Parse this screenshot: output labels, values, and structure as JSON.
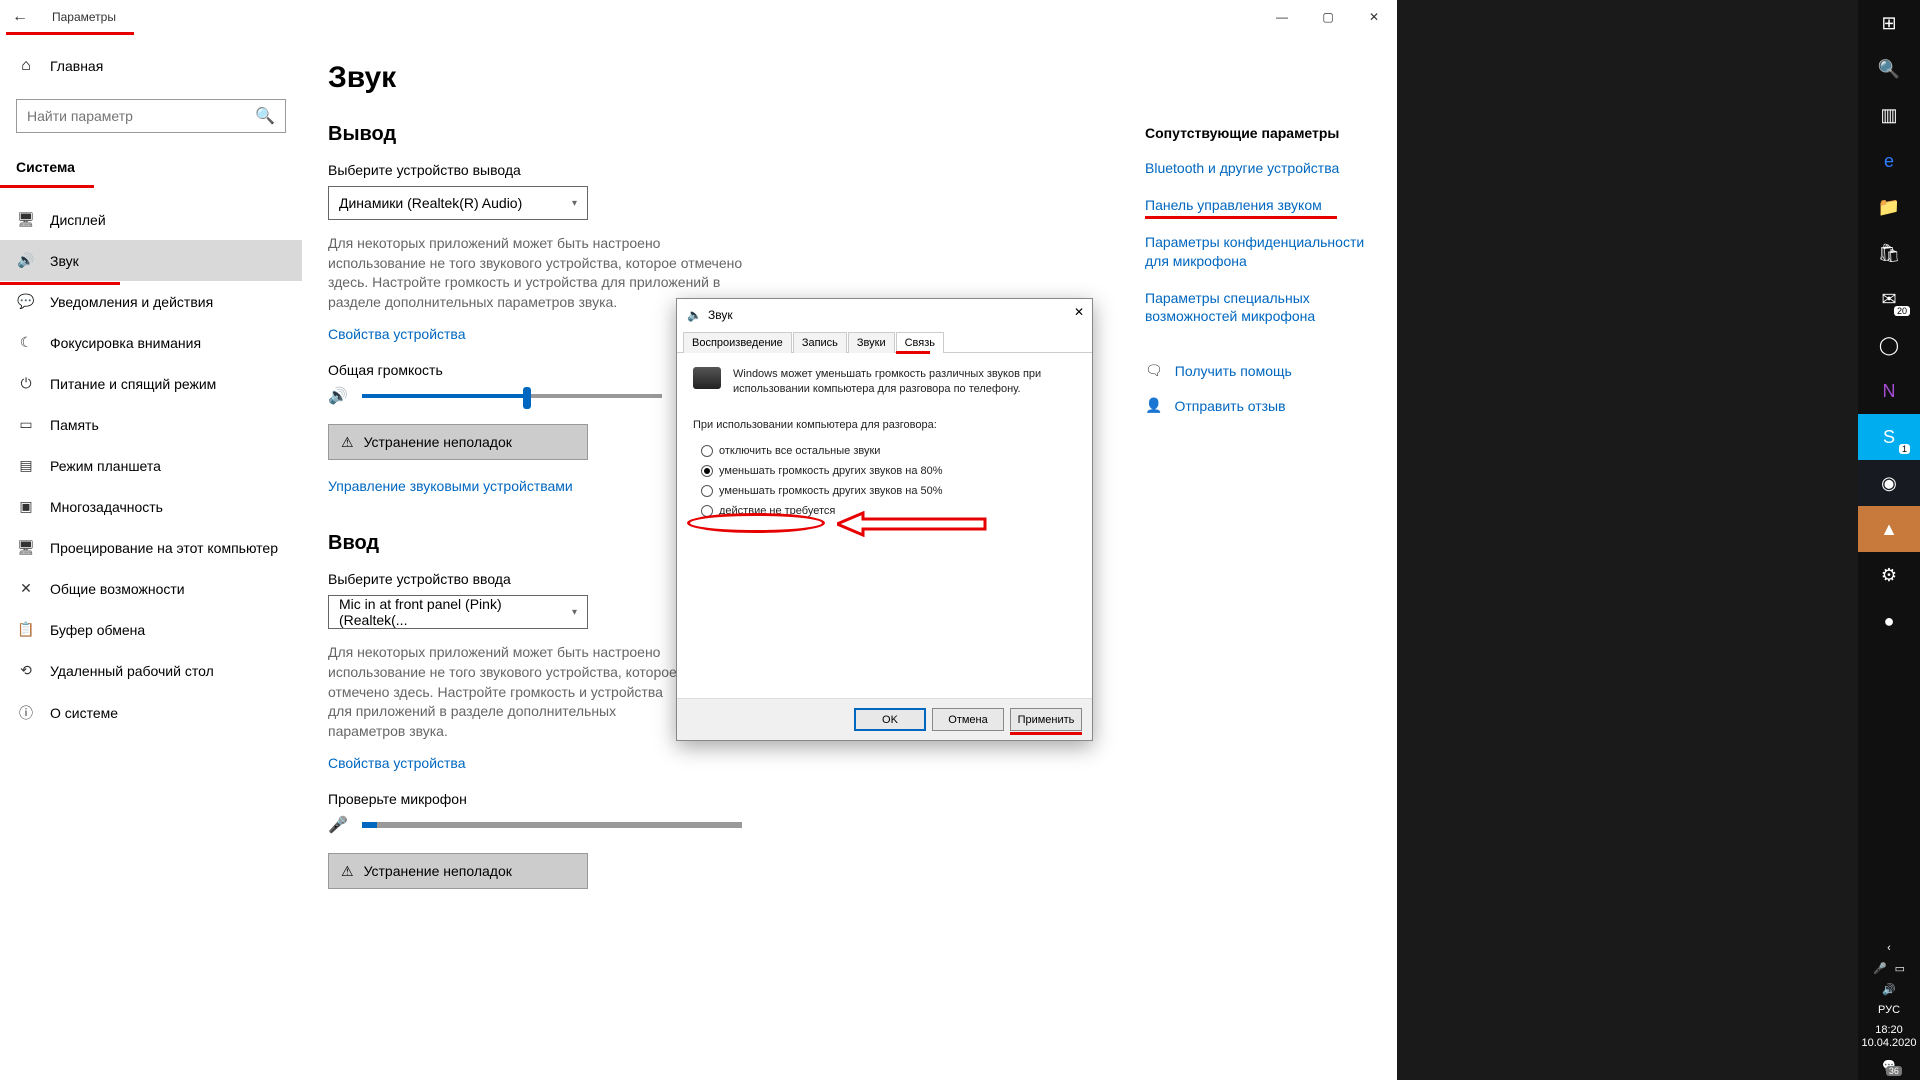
{
  "window": {
    "title": "Параметры",
    "controls": {
      "min": "—",
      "max": "▢",
      "close": "✕"
    }
  },
  "sidebar": {
    "home": "Главная",
    "search_placeholder": "Найти параметр",
    "category": "Система",
    "items": [
      {
        "icon": "🖥",
        "label": "Дисплей"
      },
      {
        "icon": "🔊",
        "label": "Звук"
      },
      {
        "icon": "💬",
        "label": "Уведомления и действия"
      },
      {
        "icon": "☾",
        "label": "Фокусировка внимания"
      },
      {
        "icon": "⏻",
        "label": "Питание и спящий режим"
      },
      {
        "icon": "▭",
        "label": "Память"
      },
      {
        "icon": "▤",
        "label": "Режим планшета"
      },
      {
        "icon": "▣",
        "label": "Многозадачность"
      },
      {
        "icon": "🖥",
        "label": "Проецирование на этот компьютер"
      },
      {
        "icon": "✕",
        "label": "Общие возможности"
      },
      {
        "icon": "📋",
        "label": "Буфер обмена"
      },
      {
        "icon": "⟲",
        "label": "Удаленный рабочий стол"
      },
      {
        "icon": "ⓘ",
        "label": "О системе"
      }
    ]
  },
  "page": {
    "title": "Звук",
    "output": {
      "heading": "Вывод",
      "device_label": "Выберите устройство вывода",
      "device_value": "Динамики (Realtek(R) Audio)",
      "desc": "Для некоторых приложений может быть настроено использование не того звукового устройства, которое отмечено здесь. Настройте громкость и устройства для приложений в разделе дополнительных параметров звука.",
      "props_link": "Свойства устройства",
      "volume_label": "Общая громкость",
      "volume_pct": 55,
      "troubleshoot": "Устранение неполадок",
      "manage_link": "Управление звуковыми устройствами"
    },
    "input": {
      "heading": "Ввод",
      "device_label": "Выберите устройство ввода",
      "device_value": "Mic in at front panel (Pink) (Realtek(...",
      "desc": "Для некоторых приложений может быть настроено использование не того звукового устройства, которое отмечено здесь. Настройте громкость и устройства для приложений в разделе дополнительных параметров звука.",
      "props_link": "Свойства устройства",
      "check_mic": "Проверьте микрофон",
      "mic_level_pct": 4,
      "troubleshoot": "Устранение неполадок"
    },
    "related": {
      "heading": "Сопутствующие параметры",
      "links": [
        "Bluetooth и другие устройства",
        "Панель управления звуком",
        "Параметры конфиденциальности для микрофона",
        "Параметры специальных возможностей микрофона"
      ],
      "help": "Получить помощь",
      "feedback": "Отправить отзыв"
    }
  },
  "dialog": {
    "title": "Звук",
    "tabs": [
      "Воспроизведение",
      "Запись",
      "Звуки",
      "Связь"
    ],
    "active_tab": 3,
    "desc": "Windows может уменьшать громкость различных звуков при использовании компьютера для разговора по телефону.",
    "radio_label": "При использовании компьютера для разговора:",
    "options": [
      "отключить все остальные звуки",
      "уменьшать громкость других звуков на 80%",
      "уменьшать громкость других звуков на 50%",
      "действие не требуется"
    ],
    "selected": 1,
    "ok": "OK",
    "cancel": "Отмена",
    "apply": "Применить"
  },
  "taskbar": {
    "lang": "РУС",
    "time": "18:20",
    "date": "10.04.2020",
    "notif_count": "36",
    "mail_badge": "20",
    "skype_badge": "1"
  }
}
